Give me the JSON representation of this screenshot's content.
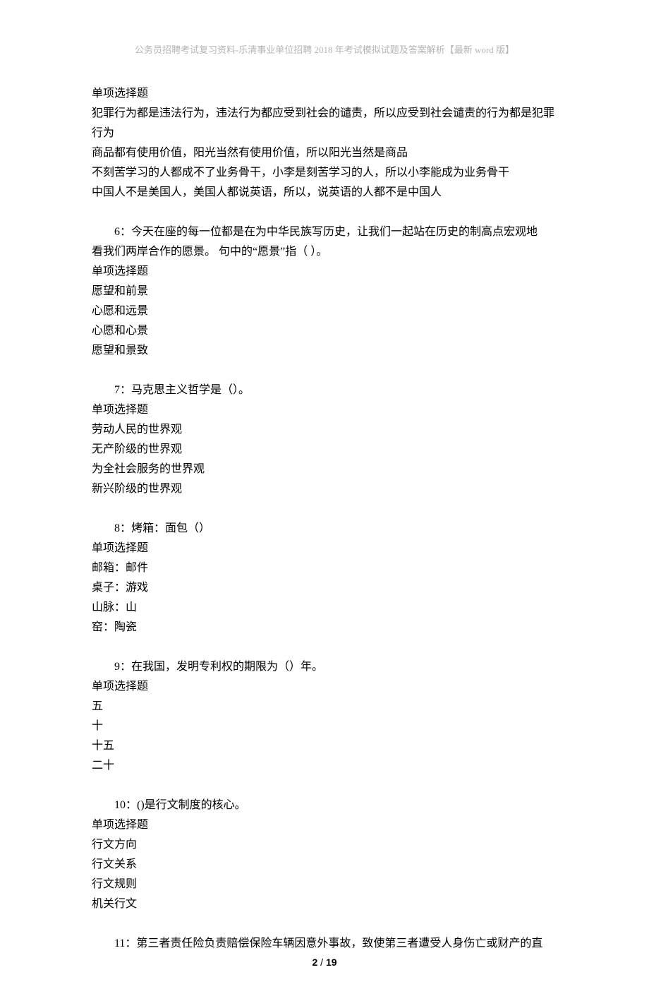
{
  "header": "公务员招聘考试复习资料-乐清事业单位招聘 2018 年考试模拟试题及答案解析【最新 word 版】",
  "cont": {
    "type_label": "单项选择题",
    "opt1": "犯罪行为都是违法行为，违法行为都应受到社会的谴责，所以应受到社会谴责的行为都是犯罪行为",
    "opt2": "商品都有使用价值，阳光当然有使用价值，所以阳光当然是商品",
    "opt3": "不刻苦学习的人都成不了业务骨干，小李是刻苦学习的人，所以小李能成为业务骨干",
    "opt4": "中国人不是美国人，美国人都说英语，所以，说英语的人都不是中国人"
  },
  "q6": {
    "stem_a": "6：今天在座的每一位都是在为中华民族写历史，让我们一起站在历史的制高点宏观地",
    "stem_b": "看我们两岸合作的愿景。  句中的“愿景”指（ ）。",
    "type_label": "单项选择题",
    "opt1": "愿望和前景",
    "opt2": "心愿和远景",
    "opt3": "心愿和心景",
    "opt4": "愿望和景致"
  },
  "q7": {
    "stem": "7：马克思主义哲学是（）。",
    "type_label": "单项选择题",
    "opt1": "劳动人民的世界观",
    "opt2": "无产阶级的世界观",
    "opt3": "为全社会服务的世界观",
    "opt4": "新兴阶级的世界观"
  },
  "q8": {
    "stem": "8：烤箱：面包（）",
    "type_label": "单项选择题",
    "opt1": "邮箱：邮件",
    "opt2": "桌子：游戏",
    "opt3": "山脉：山",
    "opt4": "窑：陶瓷"
  },
  "q9": {
    "stem": "9：在我国，发明专利权的期限为（）年。",
    "type_label": "单项选择题",
    "opt1": "五",
    "opt2": "十",
    "opt3": "十五",
    "opt4": "二十"
  },
  "q10": {
    "stem": "10：()是行文制度的核心。",
    "type_label": "单项选择题",
    "opt1": "行文方向",
    "opt2": "行文关系",
    "opt3": "行文规则",
    "opt4": "机关行文"
  },
  "q11": {
    "stem": "11：第三者责任险负责赔偿保险车辆因意外事故，致使第三者遭受人身伤亡或财产的直"
  },
  "footer": {
    "page_current": "2",
    "sep": " / ",
    "page_total": "19"
  }
}
